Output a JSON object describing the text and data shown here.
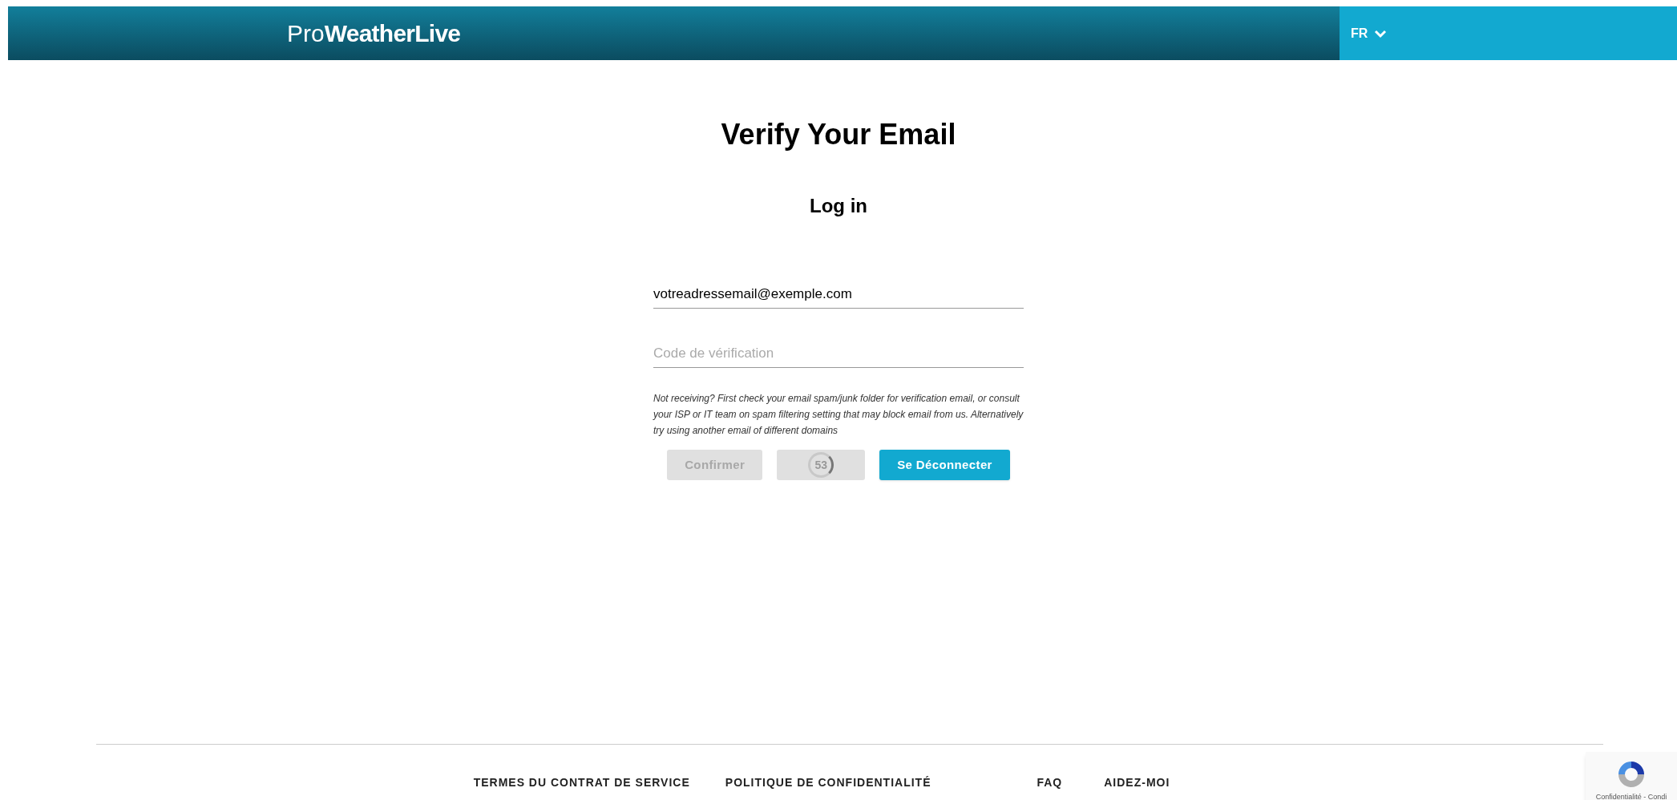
{
  "header": {
    "logo": {
      "light": "Pro",
      "bold": "WeatherLive"
    },
    "language": "FR"
  },
  "title": "Verify Your Email",
  "subtitle": "Log in",
  "fields": [
    {
      "kind": "value",
      "text": "votreadressemail@exemple.com"
    },
    {
      "kind": "placeholder",
      "placeholder": "Code de vérification"
    }
  ],
  "help_text": "Not receiving? First check your email spam/junk folder for verification email, or consult your ISP or IT team on spam filtering setting that may block email from us. Alternatively try using another email of different domains",
  "buttons": [
    {
      "kind": "text",
      "label": "Confirmer",
      "disabled": true
    },
    {
      "kind": "timer",
      "label": "53",
      "disabled": true
    },
    {
      "kind": "text",
      "label": "Se Déconnecter",
      "disabled": false
    }
  ],
  "footer_links": [
    "TERMES DU CONTRAT DE SERVICE",
    "POLITIQUE DE CONFIDENTIALITÉ",
    "FAQ",
    "AIDEZ-MOI"
  ],
  "recaptcha": {
    "text": "Confidentialité - Condi"
  }
}
